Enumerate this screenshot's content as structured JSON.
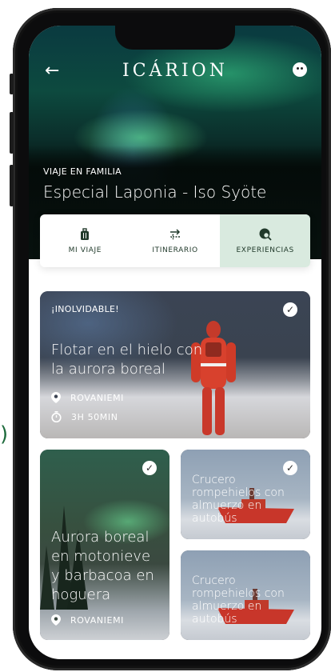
{
  "header": {
    "brand": "ICÁRION",
    "trip_tag": "VIAJE EN FAMILIA",
    "trip_title": "Especial Laponia - Iso Syöte"
  },
  "tabs": [
    {
      "label": "MI VIAJE",
      "icon": "luggage-icon"
    },
    {
      "label": "ITINERARIO",
      "icon": "swap-arrows-icon"
    },
    {
      "label": "EXPERIENCIAS",
      "icon": "search-globe-icon",
      "active": true
    }
  ],
  "cards": {
    "big": {
      "tag": "¡INOLVIDABLE!",
      "title": "Flotar en el hielo con la aurora boreal",
      "location": "ROVANIEMI",
      "duration": "3H 50MIN"
    },
    "left": {
      "title": "Aurora boreal en motonieve y barbacoa en hoguera",
      "location": "ROVANIEMI"
    },
    "right_top": {
      "title": "Crucero rompehielos con almuerzo en autobús"
    },
    "right_bottom": {
      "title": "Crucero rompehielos con almuerzo en autobús"
    }
  },
  "edge_glyph": ")",
  "colors": {
    "active_tab": "#d9eadf",
    "text_dark": "#213a2b",
    "frame": "#0c0c0d"
  }
}
